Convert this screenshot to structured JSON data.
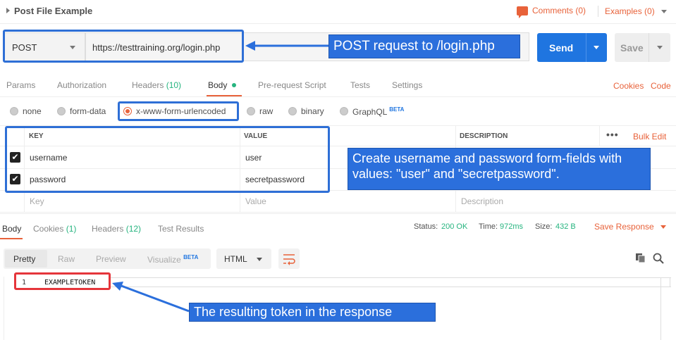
{
  "header": {
    "title": "Post File Example",
    "comments": "Comments (0)",
    "examples": "Examples (0)"
  },
  "request": {
    "method": "POST",
    "url": "https://testtraining.org/login.php",
    "send": "Send",
    "save": "Save"
  },
  "tabs": {
    "params": "Params",
    "authorization": "Authorization",
    "headers": "Headers",
    "headers_count": "(10)",
    "body": "Body",
    "prerequest": "Pre-request Script",
    "tests": "Tests",
    "settings": "Settings",
    "cookies": "Cookies",
    "code": "Code"
  },
  "body_types": {
    "none": "none",
    "form_data": "form-data",
    "urlencoded": "x-www-form-urlencoded",
    "raw": "raw",
    "binary": "binary",
    "graphql": "GraphQL",
    "beta": "BETA"
  },
  "kv_table": {
    "col_key": "KEY",
    "col_value": "VALUE",
    "col_description": "DESCRIPTION",
    "more": "•••",
    "bulk_edit": "Bulk Edit",
    "rows": [
      {
        "key": "username",
        "value": "user"
      },
      {
        "key": "password",
        "value": "secretpassword"
      }
    ],
    "placeholder_key": "Key",
    "placeholder_value": "Value",
    "placeholder_description": "Description"
  },
  "response": {
    "tabs": {
      "body": "Body",
      "cookies": "Cookies",
      "cookies_count": "(1)",
      "headers": "Headers",
      "headers_count": "(12)",
      "test_results": "Test Results"
    },
    "status_label": "Status:",
    "status_value": "200 OK",
    "time_label": "Time:",
    "time_value": "972ms",
    "size_label": "Size:",
    "size_value": "432 B",
    "save_response": "Save Response",
    "formats": {
      "pretty": "Pretty",
      "raw": "Raw",
      "preview": "Preview",
      "visualize": "Visualize",
      "beta": "BETA"
    },
    "language": "HTML",
    "line_number": "1",
    "content": "EXAMPLETOKEN"
  },
  "annotations": {
    "request": "POST request to /login.php",
    "fields": "Create username and password form-fields with values: \"user\" and \"secretpassword\".",
    "token": "The resulting token in the response"
  },
  "colors": {
    "accent": "#e8623a",
    "send": "#1f75e0",
    "success": "#26b47f",
    "annotation": "#2b6fdc",
    "highlight_red": "#e5353b"
  }
}
